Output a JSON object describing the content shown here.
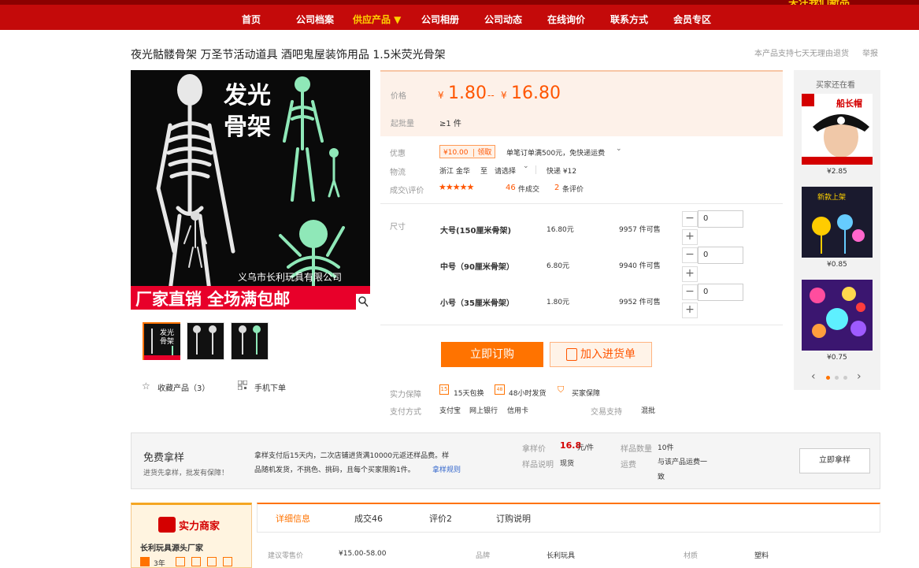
{
  "nav": {
    "items": [
      "首页",
      "公司档案",
      "供应产品 ▼",
      "公司相册",
      "公司动态",
      "在线询价",
      "联系方式",
      "会员专区"
    ],
    "corner": "关注我们新品"
  },
  "product": {
    "title": "夜光骷髅骨架 万圣节活动道具 酒吧鬼屋装饰用品 1.5米荧光骨架",
    "return_note": "本产品支持七天无理由退货",
    "report": "举报",
    "image_headline_1": "发光",
    "image_headline_2": "骨架",
    "image_company": "义乌市长利玩具有限公司",
    "image_banner": "厂家直销 全场满包邮"
  },
  "price": {
    "label": "价格",
    "currency": "¥",
    "low": "1.80",
    "sep": "--",
    "high": "16.80",
    "moq_label": "起批量",
    "moq_value": "≥1 件"
  },
  "offer": {
    "label": "优惠",
    "coupon": "¥10.00",
    "coupon_action": "领取",
    "desc": "单笔订单满500元，免快递运费"
  },
  "logistics": {
    "label": "物流",
    "from": "浙江 金华",
    "to_symbol": "至",
    "choose": "请选择",
    "express": "快递 ¥12"
  },
  "sales": {
    "label": "成交\\评价",
    "stars": "★★★★★",
    "count": "46",
    "count_suffix": "件成交",
    "reviews": "2",
    "reviews_suffix": "条评价"
  },
  "sku": {
    "label": "尺寸",
    "rows": [
      {
        "name": "大号(150厘米骨架)",
        "price": "16.80元",
        "stock": "9957 件可售",
        "qty": "0"
      },
      {
        "name": "中号（90厘米骨架）",
        "price": "6.80元",
        "stock": "9940 件可售",
        "qty": "0"
      },
      {
        "name": "小号（35厘米骨架）",
        "price": "1.80元",
        "stock": "9952 件可售",
        "qty": "0"
      }
    ]
  },
  "actions": {
    "buy": "立即订购",
    "cart": "加入进货单",
    "favorite": "收藏产品（3）",
    "mobile": "手机下单"
  },
  "guarantee": {
    "label": "实力保障",
    "items": [
      "15天包换",
      "48小时发货",
      "买家保障"
    ],
    "pay_label": "支付方式",
    "pay_items": [
      "支付宝",
      "网上银行",
      "信用卡"
    ],
    "trade_label": "交易支持",
    "trade_value": "混批"
  },
  "sidebar": {
    "title": "买家还在看",
    "items": [
      {
        "price": "¥2.85",
        "caption": "船长帽"
      },
      {
        "price": "¥0.85",
        "caption": "新款上架"
      },
      {
        "price": "¥0.75",
        "caption": ""
      }
    ]
  },
  "sample": {
    "title": "免费拿样",
    "subtitle": "进货先拿样，批发有保障！",
    "desc_1": "拿样支付后15天内，二次店铺进货满10000元返还样品费。样",
    "desc_2": "品随机发货，不挑色、挑码，且每个买家限购1件。",
    "rule_link": "拿样规则",
    "price_label": "拿样价",
    "price_value": "16.8",
    "price_unit": "元/件",
    "qty_label": "样品数量",
    "qty_value": "10件",
    "note_label": "样品说明",
    "note_value": "现货",
    "freight_label": "运费",
    "freight_value_1": "与该产品运费一",
    "freight_value_2": "致",
    "button": "立即拿样"
  },
  "merchant": {
    "badge": "实力商家",
    "name": "长利玩具源头厂家",
    "years": "3年"
  },
  "tabs": [
    "详细信息",
    "成交46",
    "评价2",
    "订购说明"
  ],
  "specs": {
    "price_label": "建议零售价",
    "price_value": "¥15.00-58.00",
    "brand_label": "品牌",
    "brand_value": "长利玩具",
    "material_label": "材质",
    "material_value": "塑料"
  },
  "colors": {
    "accent": "#ff7300",
    "nav_bg": "#c40a0a",
    "price": "#ff5500"
  }
}
